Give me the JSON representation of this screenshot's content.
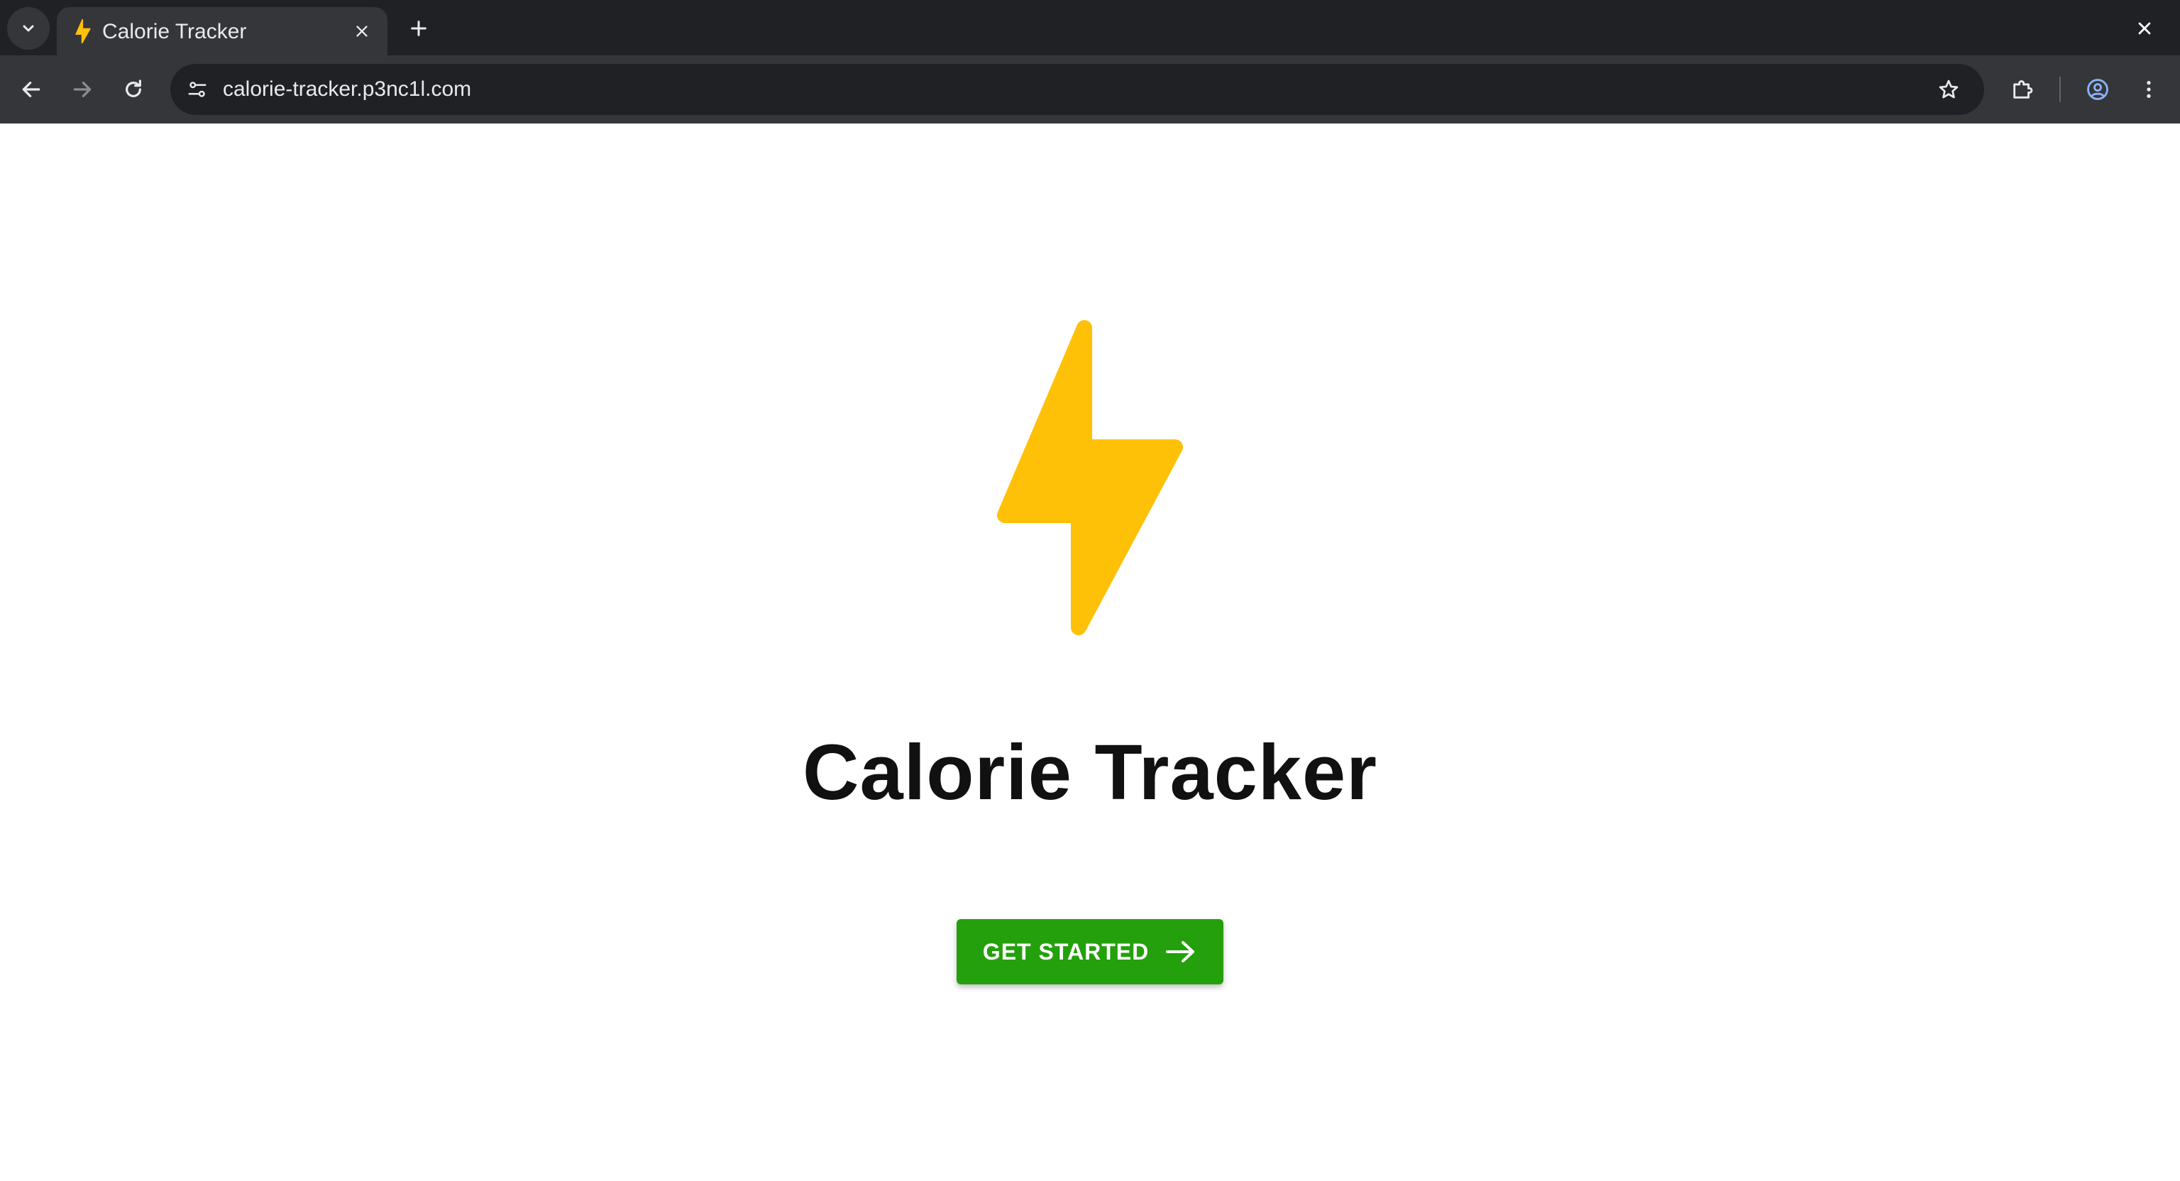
{
  "browser": {
    "tab": {
      "title": "Calorie Tracker",
      "favicon": "lightning-bolt-icon"
    },
    "address_bar": {
      "url": "calorie-tracker.p3nc1l.com"
    },
    "icons": {
      "tab_list": "chevron-down-icon",
      "tab_close": "close-icon",
      "new_tab": "plus-icon",
      "window_close": "close-icon",
      "back": "arrow-left-icon",
      "forward": "arrow-right-icon",
      "reload": "reload-icon",
      "site_info": "tune-icon",
      "bookmark": "star-icon",
      "extensions": "puzzle-icon",
      "profile": "account-circle-icon",
      "menu": "more-vert-icon"
    }
  },
  "page": {
    "hero_icon": "lightning-bolt-icon",
    "title": "Calorie Tracker",
    "cta": {
      "label": "GET STARTED",
      "icon": "arrow-right-icon"
    }
  },
  "colors": {
    "bolt": "#FFC107",
    "cta_background": "#24A00C",
    "chrome_dark": "#202124",
    "chrome_toolbar": "#35363A"
  }
}
